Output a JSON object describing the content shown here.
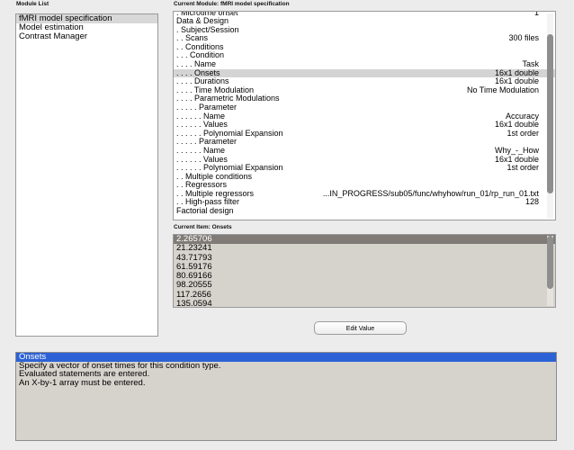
{
  "labels": {
    "module_list": "Module List",
    "current_module": "Current Module: fMRI model specification",
    "current_item": "Current Item: Onsets"
  },
  "modules": [
    {
      "label": "fMRI model specification",
      "selected": true
    },
    {
      "label": "Model estimation",
      "selected": false
    },
    {
      "label": "Contrast Manager",
      "selected": false
    }
  ],
  "tree": [
    {
      "label": ". Microtime onset",
      "value": "1",
      "cut": true
    },
    {
      "label": "Data & Design",
      "value": ""
    },
    {
      "label": ". Subject/Session",
      "value": ""
    },
    {
      "label": ". . Scans",
      "value": "300 files"
    },
    {
      "label": ". . Conditions",
      "value": ""
    },
    {
      "label": ". . . Condition",
      "value": ""
    },
    {
      "label": ". . . . Name",
      "value": "Task"
    },
    {
      "label": ". . . . Onsets",
      "value": "16x1 double",
      "selected": true
    },
    {
      "label": ". . . . Durations",
      "value": "16x1 double"
    },
    {
      "label": ". . . . Time Modulation",
      "value": "No Time Modulation"
    },
    {
      "label": ". . . . Parametric Modulations",
      "value": ""
    },
    {
      "label": ". . . . . Parameter",
      "value": ""
    },
    {
      "label": ". . . . . . Name",
      "value": "Accuracy"
    },
    {
      "label": ". . . . . . Values",
      "value": "16x1 double"
    },
    {
      "label": ". . . . . . Polynomial Expansion",
      "value": "1st order"
    },
    {
      "label": ". . . . . Parameter",
      "value": ""
    },
    {
      "label": ". . . . . . Name",
      "value": "Why_-_How"
    },
    {
      "label": ". . . . . . Values",
      "value": "16x1 double"
    },
    {
      "label": ". . . . . . Polynomial Expansion",
      "value": "1st order"
    },
    {
      "label": ". . Multiple conditions",
      "value": ""
    },
    {
      "label": ". . Regressors",
      "value": ""
    },
    {
      "label": ". . Multiple regressors",
      "value": "...IN_PROGRESS/sub05/func/whyhow/run_01/rp_run_01.txt"
    },
    {
      "label": ". . High-pass filter",
      "value": "128"
    },
    {
      "label": "Factorial design",
      "value": ""
    }
  ],
  "tree_scroll": {
    "position": 0.45,
    "extent": 0.78
  },
  "current_item_values": [
    {
      "text": "2.265706",
      "selected": true
    },
    {
      "text": "21.23241"
    },
    {
      "text": "43.71793"
    },
    {
      "text": "61.59176"
    },
    {
      "text": "80.69166"
    },
    {
      "text": "98.20555"
    },
    {
      "text": "117.2656"
    },
    {
      "text": "135.0594"
    }
  ],
  "item_scroll": {
    "position": 0.0,
    "extent": 0.75
  },
  "edit_button": "Edit Value",
  "help": [
    {
      "text": "Onsets",
      "selected": true
    },
    {
      "text": "Specify a vector of onset times for this condition type."
    },
    {
      "text": "Evaluated statements are entered."
    },
    {
      "text": "An X-by-1 array must be entered."
    }
  ],
  "colors": {
    "selection_blue": "#2d62d6",
    "item_selection": "#807b76",
    "tree_selection": "#d4d4d4",
    "panel_gray": "#d6d2cc"
  }
}
